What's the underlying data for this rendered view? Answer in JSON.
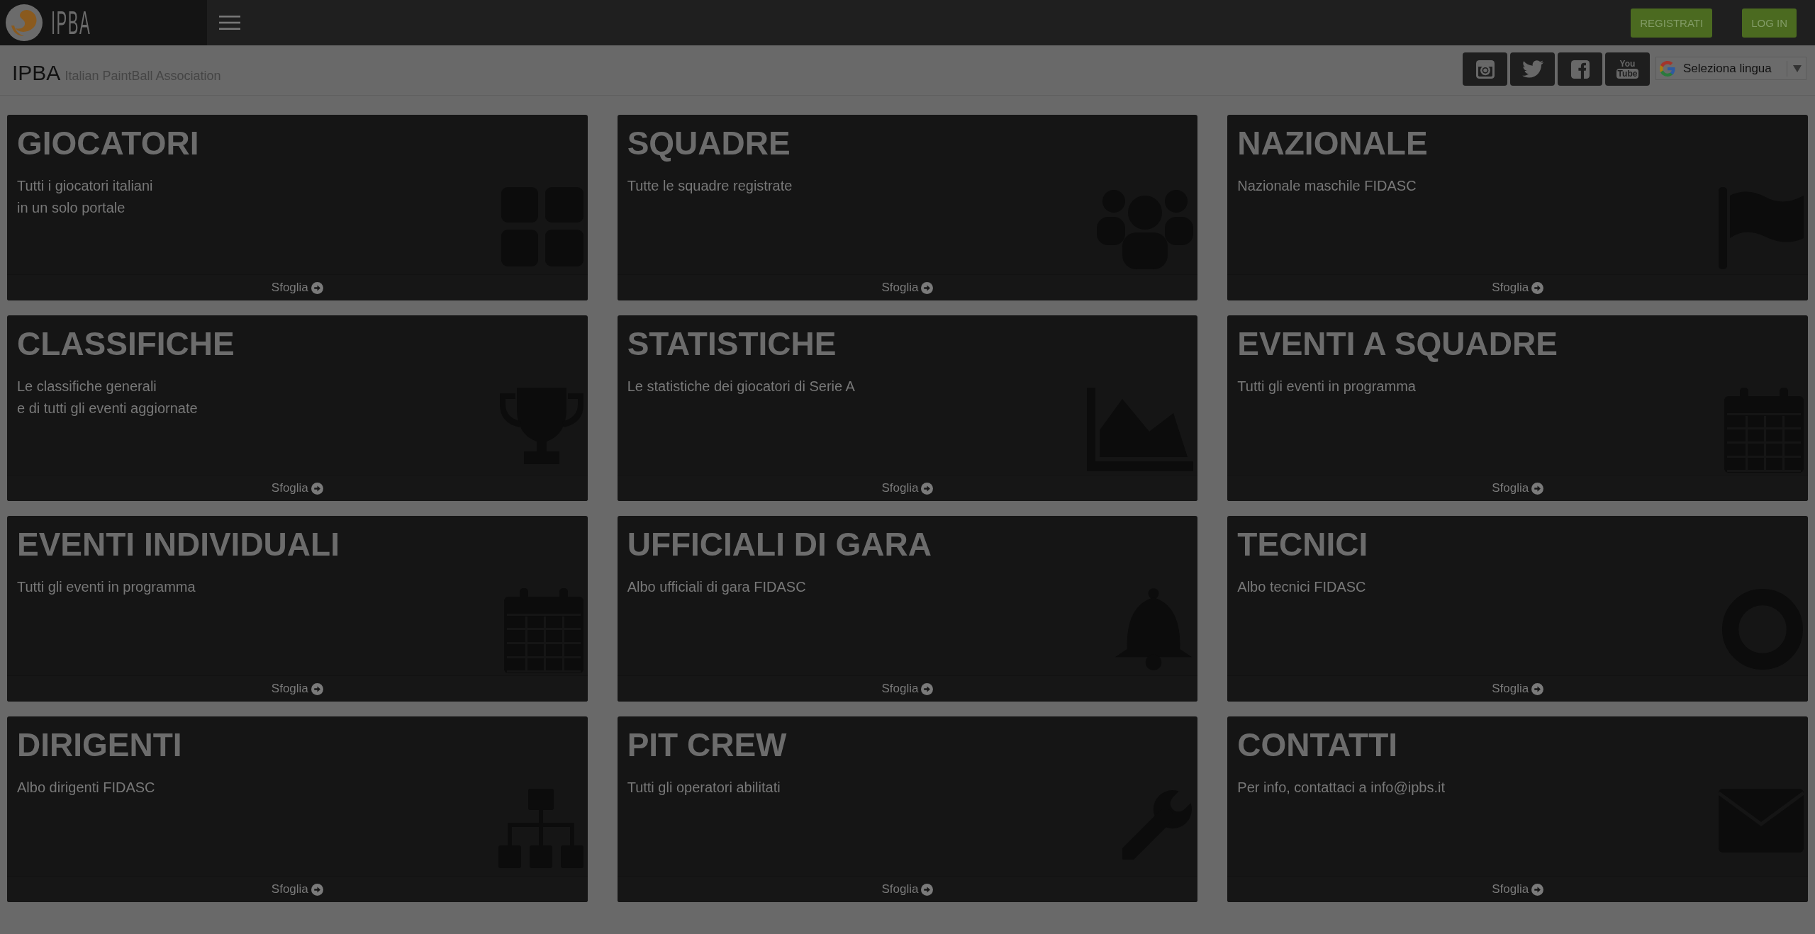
{
  "top_bar": {
    "logo_text": "IPBA",
    "buttons": [
      "REGISTRATI",
      "LOG IN"
    ]
  },
  "header": {
    "title": "IPBA",
    "tagline": "Italian PaintBall Association",
    "youtube_logo": {
      "top": "You",
      "bottom": "Tube"
    },
    "language_selector": {
      "label": "Seleziona lingua"
    }
  },
  "cards": [
    {
      "title": "GIOCATORI",
      "description": "Tutti i giocatori italiani\nin un solo portale",
      "link": "Sfoglia"
    },
    {
      "title": "SQUADRE",
      "description": "Tutte le squadre registrate",
      "link": "Sfoglia"
    },
    {
      "title": "NAZIONALE",
      "description": "Nazionale maschile FIDASC",
      "link": "Sfoglia"
    },
    {
      "title": "CLASSIFICHE",
      "description": "Le classifiche generali\ne di tutti gli eventi aggiornate",
      "link": "Sfoglia"
    },
    {
      "title": "STATISTICHE",
      "description": "Le statistiche dei giocatori di Serie A",
      "link": "Sfoglia"
    },
    {
      "title": "EVENTI A SQUADRE",
      "description": "Tutti gli eventi in programma",
      "link": "Sfoglia"
    },
    {
      "title": "EVENTI INDIVIDUALI",
      "description": "Tutti gli eventi in programma",
      "link": "Sfoglia"
    },
    {
      "title": "UFFICIALI DI GARA",
      "description": "Albo ufficiali di gara FIDASC",
      "link": "Sfoglia"
    },
    {
      "title": "TECNICI",
      "description": "Albo tecnici FIDASC",
      "link": "Sfoglia"
    },
    {
      "title": "DIRIGENTI",
      "description": "Albo dirigenti FIDASC",
      "link": "Sfoglia"
    },
    {
      "title": "PIT CREW",
      "description": "Tutti gli operatori abilitati",
      "link": "Sfoglia"
    },
    {
      "title": "CONTATTI",
      "description": "Per info, contattaci a info@ipbs.it",
      "link": "Sfoglia"
    }
  ]
}
